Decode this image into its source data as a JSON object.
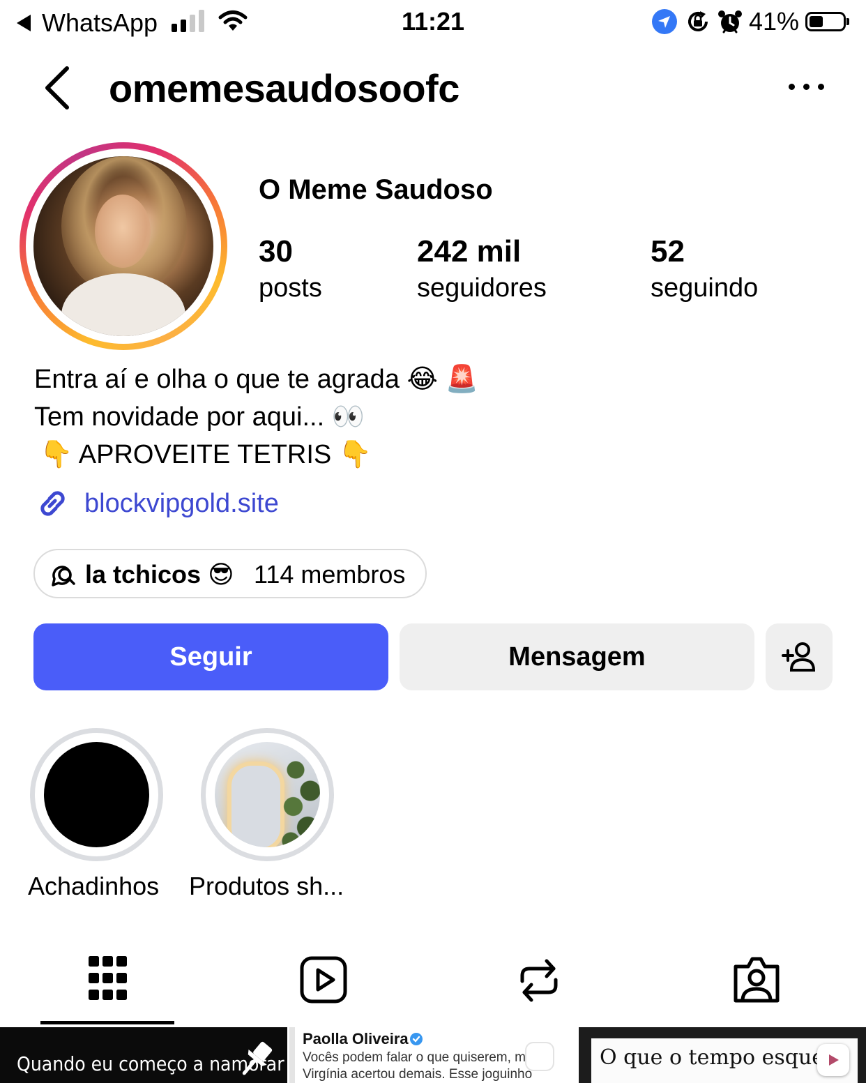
{
  "status_bar": {
    "back_app": "WhatsApp",
    "time": "11:21",
    "battery_percent": "41%",
    "battery_level": 0.41,
    "signal_bars_active": 2,
    "signal_bars_total": 4
  },
  "header": {
    "username": "omemesaudosoofc"
  },
  "profile": {
    "display_name": "O Meme Saudoso",
    "stats": [
      {
        "count": "30",
        "label": "posts"
      },
      {
        "count": "242 mil",
        "label": "seguidores"
      },
      {
        "count": "52",
        "label": "seguindo"
      }
    ],
    "bio": [
      "Entra aí e olha o que te agrada 😂 🚨",
      "Tem novidade por aqui... 👀",
      "👇 APROVEITE TETRIS 👇"
    ],
    "link": "blockvipgold.site",
    "channel": {
      "name": "la tchicos 😎",
      "members": "114 membros"
    }
  },
  "actions": {
    "follow_label": "Seguir",
    "message_label": "Mensagem"
  },
  "highlights": [
    {
      "label": "Achadinhos"
    },
    {
      "label": "Produtos sh..."
    }
  ],
  "tabs": [
    "grid-icon",
    "reels-icon",
    "reposts-icon",
    "tagged-icon"
  ],
  "posts_preview": [
    {
      "text": "Quando eu começo a namorar"
    },
    {
      "author": "Paolla Oliveira",
      "line1": "Vocês podem falar o que quiserem, m",
      "line2": "Virgínia acertou demais. Esse joguinho"
    },
    {
      "text": "O que o tempo esquece"
    }
  ],
  "colors": {
    "follow_button": "#4a5df9",
    "link": "#3d48d1",
    "secondary_button": "#efefef",
    "verified": "#3897f0"
  }
}
